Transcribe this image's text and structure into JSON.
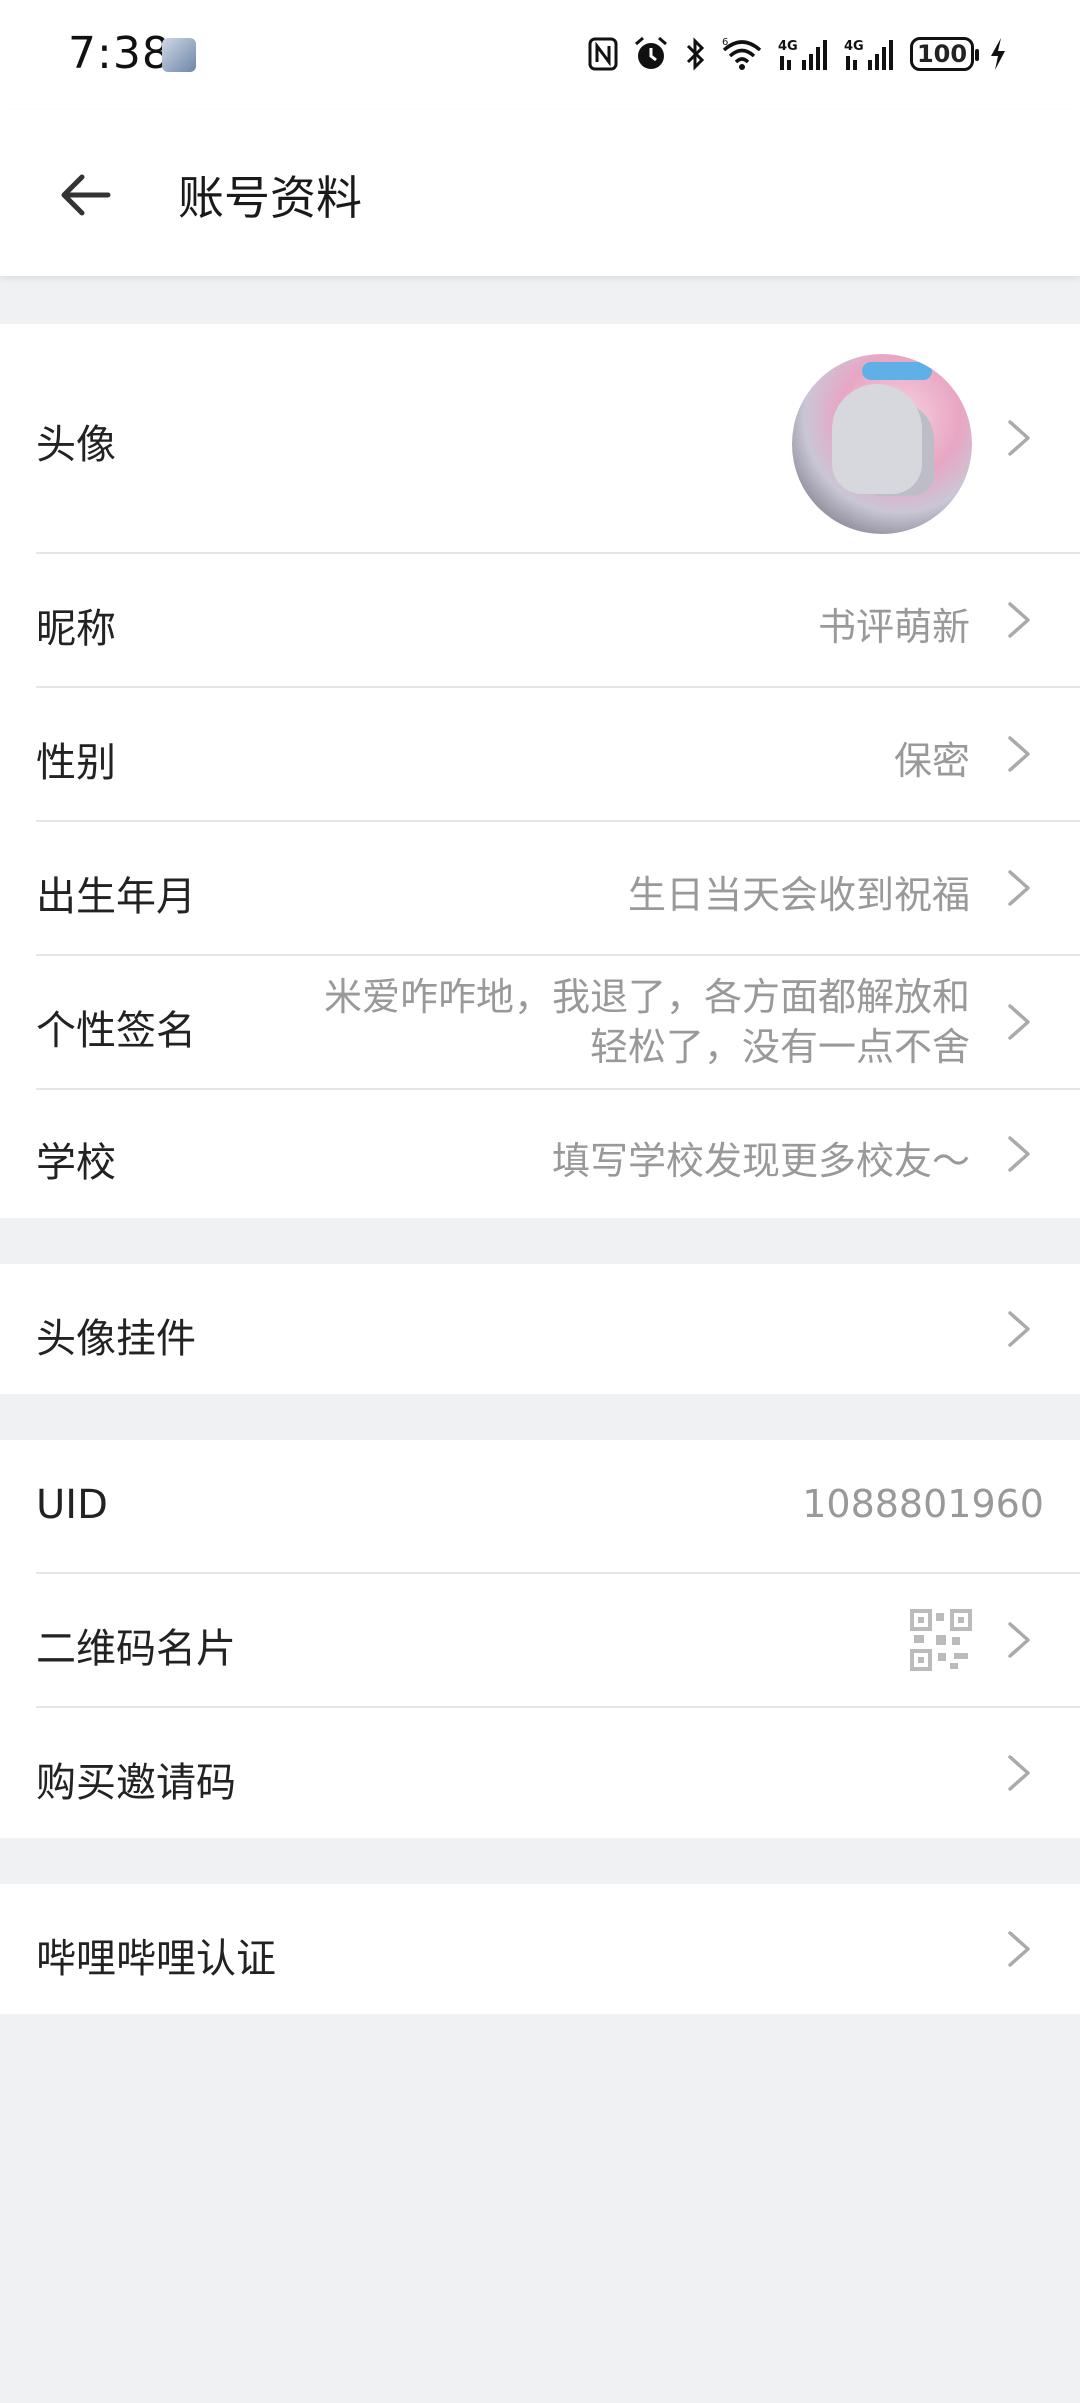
{
  "status_bar": {
    "time": "7:38",
    "battery": "100",
    "icons": [
      "nfc-icon",
      "alarm-icon",
      "bluetooth-icon",
      "wifi-icon",
      "signal-4g-icon",
      "signal-4g-icon",
      "battery-icon",
      "charging-icon"
    ]
  },
  "header": {
    "title": "账号资料",
    "back_icon": "back-arrow-icon"
  },
  "section1": {
    "avatar_label": "头像",
    "nickname_label": "昵称",
    "nickname_value": "书评萌新",
    "gender_label": "性别",
    "gender_value": "保密",
    "birthday_label": "出生年月",
    "birthday_value": "生日当天会收到祝福",
    "signature_label": "个性签名",
    "signature_line1": "米爱咋咋地，我退了，各方面都解放和",
    "signature_line2": "轻松了，没有一点不舍",
    "school_label": "学校",
    "school_value": "填写学校发现更多校友～"
  },
  "section2": {
    "pendant_label": "头像挂件"
  },
  "section3": {
    "uid_label": "UID",
    "uid_value": "1088801960",
    "qrcode_label": "二维码名片",
    "invite_label": "购买邀请码"
  },
  "section4": {
    "cert_label": "哔哩哔哩认证"
  },
  "colors": {
    "background": "#f0f1f3",
    "card": "#ffffff",
    "label_text": "#222222",
    "value_text": "#999999",
    "divider": "#e6e6e6"
  }
}
